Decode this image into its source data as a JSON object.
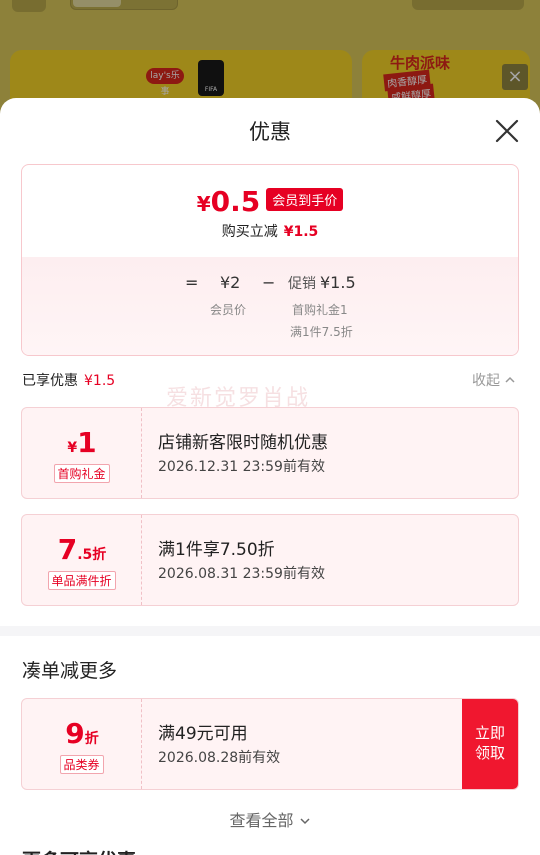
{
  "background": {
    "brand_logo": "lay's乐事",
    "fifa_label": "FIFA",
    "promo_title": "牛肉派味",
    "promo_line1": "肉香醇厚",
    "promo_line2": "咸鲜醇厚"
  },
  "sheet": {
    "title": "优惠",
    "close_icon": "close-icon"
  },
  "summary": {
    "currency": "¥",
    "final_price": "0.5",
    "price_tag": "会员到手价",
    "buy_reduce_label": "购买立减",
    "buy_reduce_amount": "¥1.5",
    "equals": "=",
    "member_price": "¥2",
    "minus": "−",
    "promo_label": "促销",
    "promo_amount": "¥1.5",
    "member_price_label": "会员价",
    "gift_label": "首购礼金1",
    "discount_label": "满1件7.5折"
  },
  "enjoyed": {
    "label": "已享优惠",
    "amount": "¥1.5",
    "collapse_label": "收起"
  },
  "watermark": "爱新觉罗肖战",
  "coupons": [
    {
      "value_prefix": "¥",
      "value": "1",
      "value_suffix": "",
      "tag": "首购礼金",
      "desc": "店铺新客限时随机优惠",
      "expire": "2026.12.31 23:59前有效"
    },
    {
      "value_prefix": "",
      "value": "7",
      "value_suffix": ".5折",
      "tag": "单品满件折",
      "desc": "满1件享7.50折",
      "expire": "2026.08.31 23:59前有效"
    }
  ],
  "more": {
    "title": "凑单减更多",
    "coupon": {
      "value": "9",
      "value_suffix": "折",
      "tag": "品类券",
      "desc": "满49元可用",
      "expire": "2026.08.28前有效",
      "claim_line1": "立即",
      "claim_line2": "领取"
    },
    "view_all": "查看全部",
    "next_section": "更多可享优惠"
  },
  "colors": {
    "accent": "#e60023",
    "claim_button": "#f0172f",
    "card_bg": "#fff3f4"
  }
}
